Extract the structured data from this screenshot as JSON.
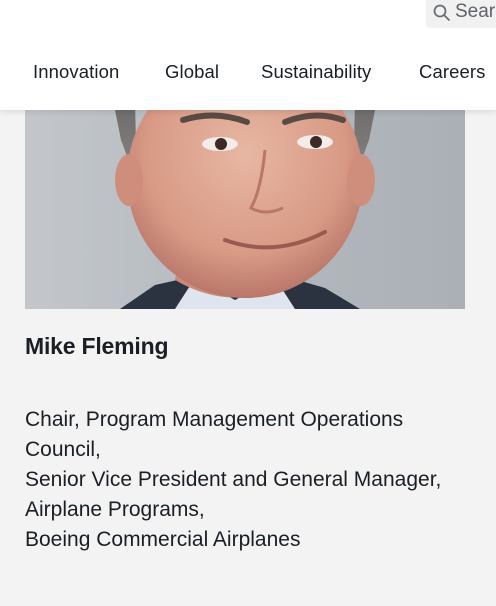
{
  "search": {
    "placeholder": "Search"
  },
  "nav": {
    "items": [
      {
        "label": "Innovation"
      },
      {
        "label": "Global"
      },
      {
        "label": "Sustainability"
      },
      {
        "label": "Careers"
      }
    ]
  },
  "profile": {
    "name": "Mike Fleming",
    "title_lines": [
      "Chair, Program Management Operations",
      "Council,",
      "Senior Vice President and General Manager,",
      "Airplane Programs,",
      "Boeing Commercial Airplanes"
    ]
  },
  "colors": {
    "page_background": "#f3f3f4",
    "header_background": "#ffffff",
    "text": "#1a1f24",
    "photo_background": "#b9bec3"
  }
}
